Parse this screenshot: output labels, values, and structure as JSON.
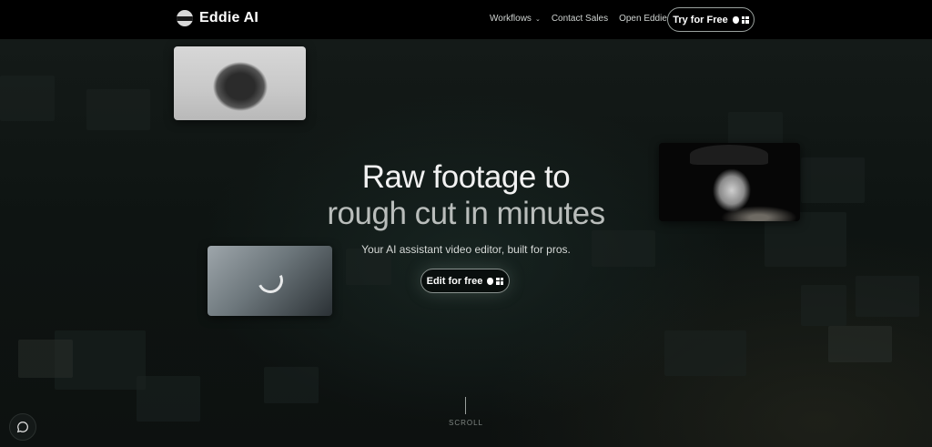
{
  "nav": {
    "logo_text": "Eddie AI",
    "links": [
      {
        "label": "Workflows",
        "has_dropdown": true
      },
      {
        "label": "Contact Sales"
      },
      {
        "label": "Open Eddie"
      }
    ],
    "cta_label": "Try for Free"
  },
  "hero": {
    "headline_line1": "Raw footage to",
    "headline_line2": "rough cut in minutes",
    "subtitle": "Your AI assistant video editor, built for pros.",
    "cta_label": "Edit for free"
  },
  "scroll": {
    "label": "SCROLL"
  },
  "icons": {
    "logo": "eddie-logo-icon",
    "dropdown": "chevron-down-icon",
    "apple": "apple-icon",
    "windows": "windows-icon",
    "chat": "chat-bubble-icon"
  },
  "colors": {
    "background": "#0b0f0e",
    "nav": "#000000",
    "text": "#ffffff",
    "muted": "#b9bdbb"
  }
}
